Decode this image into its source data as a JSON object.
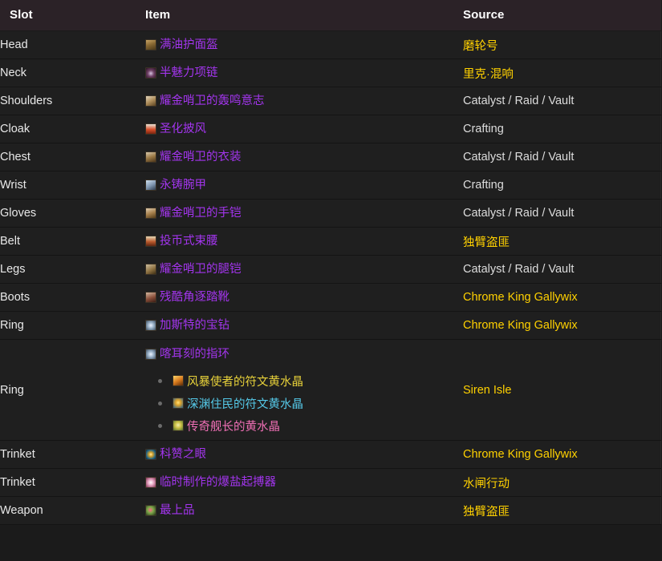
{
  "table": {
    "columns": [
      {
        "key": "slot",
        "label": "Slot"
      },
      {
        "key": "item",
        "label": "Item"
      },
      {
        "key": "source",
        "label": "Source"
      }
    ],
    "rows": [
      {
        "slot": "Head",
        "item": {
          "name": "满油护面盔",
          "quality": "epic",
          "icon": "helm-icon"
        },
        "source": {
          "text": "磨轮号",
          "style": "gold"
        }
      },
      {
        "slot": "Neck",
        "item": {
          "name": "半魅力项链",
          "quality": "epic",
          "icon": "necklace-icon"
        },
        "source": {
          "text": "里克·混响",
          "style": "gold"
        }
      },
      {
        "slot": "Shoulders",
        "item": {
          "name": "耀金哨卫的轰鸣意志",
          "quality": "epic",
          "icon": "shoulder-icon"
        },
        "source": {
          "text": "Catalyst / Raid / Vault",
          "style": "plain"
        }
      },
      {
        "slot": "Cloak",
        "item": {
          "name": "圣化披风",
          "quality": "epic",
          "icon": "cloak-icon"
        },
        "source": {
          "text": "Crafting",
          "style": "plain"
        }
      },
      {
        "slot": "Chest",
        "item": {
          "name": "耀金哨卫的衣装",
          "quality": "epic",
          "icon": "chest-icon"
        },
        "source": {
          "text": "Catalyst / Raid / Vault",
          "style": "plain"
        }
      },
      {
        "slot": "Wrist",
        "item": {
          "name": "永铸腕甲",
          "quality": "epic",
          "icon": "wrist-icon"
        },
        "source": {
          "text": "Crafting",
          "style": "plain"
        }
      },
      {
        "slot": "Gloves",
        "item": {
          "name": "耀金哨卫的手铠",
          "quality": "epic",
          "icon": "gloves-icon"
        },
        "source": {
          "text": "Catalyst / Raid / Vault",
          "style": "plain"
        }
      },
      {
        "slot": "Belt",
        "item": {
          "name": "投币式束腰",
          "quality": "epic",
          "icon": "belt-icon"
        },
        "source": {
          "text": "独臂盗匪",
          "style": "gold"
        }
      },
      {
        "slot": "Legs",
        "item": {
          "name": "耀金哨卫的腿铠",
          "quality": "epic",
          "icon": "legs-icon"
        },
        "source": {
          "text": "Catalyst / Raid / Vault",
          "style": "plain"
        }
      },
      {
        "slot": "Boots",
        "item": {
          "name": "残酷角逐踏靴",
          "quality": "epic",
          "icon": "boots-icon"
        },
        "source": {
          "text": "Chrome King Gallywix",
          "style": "gold"
        }
      },
      {
        "slot": "Ring",
        "item": {
          "name": "加斯特的宝钻",
          "quality": "epic",
          "icon": "ring-icon"
        },
        "source": {
          "text": "Chrome King Gallywix",
          "style": "gold"
        }
      },
      {
        "slot": "Ring",
        "item": {
          "name": "喀耳刻的指环",
          "quality": "epic",
          "icon": "ring-icon"
        },
        "gems": [
          {
            "name": "风暴使者的符文黄水晶",
            "quality": "yellow",
            "icon": "gem-yellow-icon"
          },
          {
            "name": "深渊住民的符文黄水晶",
            "quality": "cyan",
            "icon": "gem-cyan-icon"
          },
          {
            "name": "传奇舰长的黄水晶",
            "quality": "pink",
            "icon": "gem-pink-icon"
          }
        ],
        "source": {
          "text": "Siren Isle",
          "style": "gold"
        }
      },
      {
        "slot": "Trinket",
        "item": {
          "name": "科赞之眼",
          "quality": "epic",
          "icon": "trinket-eye-icon"
        },
        "source": {
          "text": "Chrome King Gallywix",
          "style": "gold"
        }
      },
      {
        "slot": "Trinket",
        "item": {
          "name": "临时制作的爆盐起搏器",
          "quality": "epic",
          "icon": "trinket-pacemaker-icon"
        },
        "source": {
          "text": "水闸行动",
          "style": "gold"
        }
      },
      {
        "slot": "Weapon",
        "item": {
          "name": "最上品",
          "quality": "epic",
          "icon": "weapon-icon"
        },
        "source": {
          "text": "独臂盗匪",
          "style": "gold"
        }
      }
    ]
  },
  "colors": {
    "epic": "#a335ee",
    "gold": "#ffd100",
    "plain": "#dddddd",
    "gem_yellow": "#e8d23a",
    "gem_cyan": "#55c9e8",
    "gem_pink": "#ef6fb5",
    "header_bg": "#2b2227",
    "row_bg": "#1f1f1f"
  }
}
